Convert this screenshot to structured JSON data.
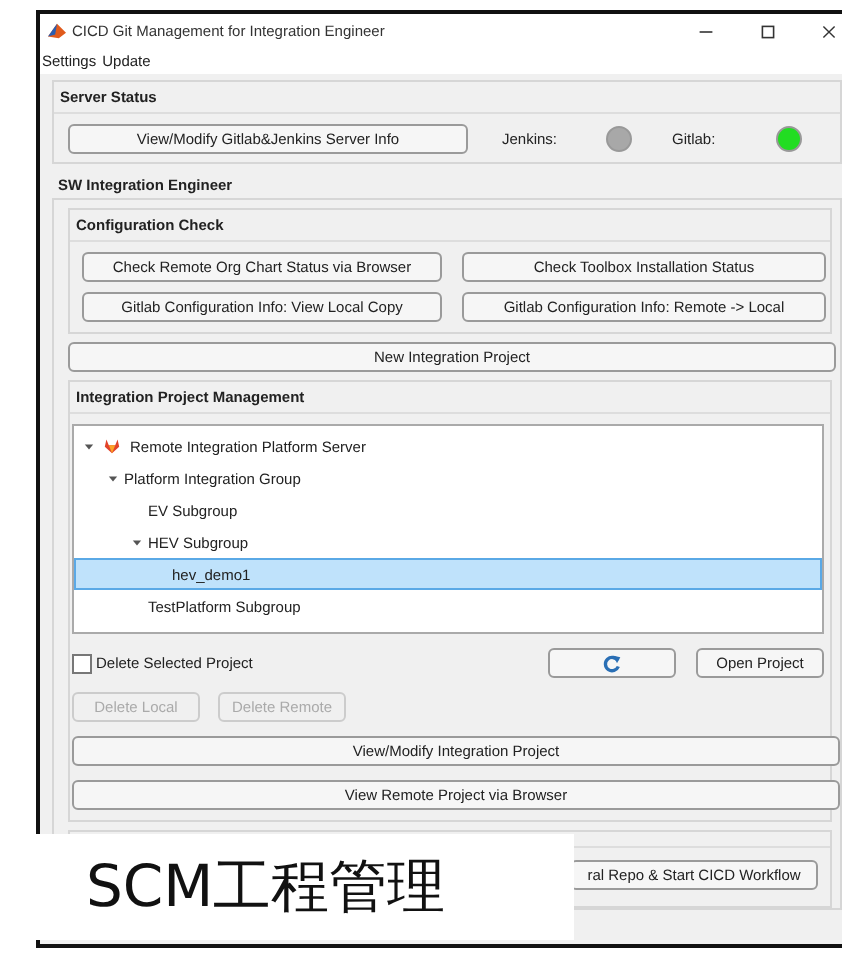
{
  "window": {
    "title": "CICD Git Management for Integration Engineer"
  },
  "menu": [
    "Settings",
    "Update"
  ],
  "server_status": {
    "title": "Server Status",
    "button": "View/Modify Gitlab&Jenkins Server Info",
    "indicators": [
      {
        "label": "Jenkins:",
        "color": "#a8a8a8"
      },
      {
        "label": "Gitlab:",
        "color": "#22dd22"
      }
    ]
  },
  "sw_integration": {
    "title": "SW Integration Engineer",
    "configuration_check": {
      "title": "Configuration Check",
      "buttons": [
        "Check Remote Org Chart Status via Browser",
        "Check Toolbox Installation Status",
        "Gitlab Configuration Info: View Local Copy",
        "Gitlab Configuration Info: Remote -> Local"
      ]
    },
    "new_project_button": "New Integration Project",
    "project_management": {
      "title": "Integration Project Management",
      "tree": [
        {
          "label": "Remote Integration Platform Server",
          "kind": "server",
          "expanded": true,
          "selected": false,
          "children": [
            {
              "label": "Platform Integration Group",
              "expanded": true,
              "selected": false,
              "children": [
                {
                  "label": "EV Subgroup",
                  "selected": false
                },
                {
                  "label": "HEV Subgroup",
                  "expanded": true,
                  "selected": false,
                  "children": [
                    {
                      "label": "hev_demo1",
                      "selected": true
                    }
                  ]
                },
                {
                  "label": "TestPlatform Subgroup",
                  "selected": false
                }
              ]
            }
          ]
        }
      ],
      "delete_selected": {
        "label": "Delete Selected Project",
        "checked": false
      },
      "open_button": "Open Project",
      "delete_buttons": [
        {
          "label": "Delete Local",
          "disabled": true
        },
        {
          "label": "Delete Remote",
          "disabled": true
        }
      ],
      "buttons": [
        "View/Modify Integration Project",
        "View Remote Project via Browser"
      ]
    },
    "workflow_button": "ral Repo & Start CICD Workflow"
  },
  "caption": "SCM工程管理"
}
